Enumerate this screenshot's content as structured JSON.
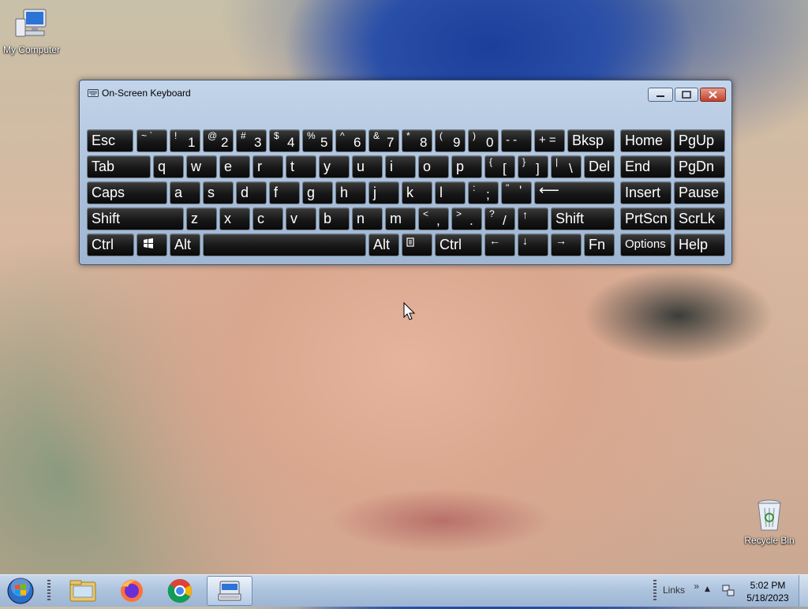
{
  "desktop": {
    "icons": [
      {
        "label": "My Computer",
        "icon": "computer-icon"
      },
      {
        "label": "Recycle Bin",
        "icon": "recycle-bin-icon"
      }
    ]
  },
  "osk": {
    "title": "On-Screen Keyboard",
    "keys": {
      "esc": "Esc",
      "tilde": "~ `",
      "k1s": "!",
      "k1": "1",
      "k2s": "@",
      "k2": "2",
      "k3s": "#",
      "k3": "3",
      "k4s": "$",
      "k4": "4",
      "k5s": "%",
      "k5": "5",
      "k6s": "^",
      "k6": "6",
      "k7s": "&",
      "k7": "7",
      "k8s": "*",
      "k8": "8",
      "k9s": "(",
      "k9": "9",
      "k0s": ")",
      "k0": "0",
      "minus": "- -",
      "plus": "+ =",
      "bksp": "Bksp",
      "home": "Home",
      "pgup": "PgUp",
      "tab": "Tab",
      "q": "q",
      "w": "w",
      "e": "e",
      "r": "r",
      "t": "t",
      "y": "y",
      "u": "u",
      "i": "i",
      "o": "o",
      "p": "p",
      "lbrs": "{",
      "lbr": "[",
      "rbrs": "}",
      "rbr": "]",
      "pipes": "|",
      "pipe": "\\",
      "del": "Del",
      "end": "End",
      "pgdn": "PgDn",
      "caps": "Caps",
      "a": "a",
      "s": "s",
      "d": "d",
      "f": "f",
      "g": "g",
      "h": "h",
      "j": "j",
      "k": "k",
      "l": "l",
      "semis": ":",
      "semi": ";",
      "quotes": "\"",
      "quote": "'",
      "enter": "⟵",
      "insert": "Insert",
      "pause": "Pause",
      "shift": "Shift",
      "z": "z",
      "x": "x",
      "c": "c",
      "v": "v",
      "b": "b",
      "n": "n",
      "m": "m",
      "commas": "<",
      "comma": ",",
      "periods": ">",
      "period": ".",
      "slashs": "?",
      "slash": "/",
      "up": "↑",
      "shift2": "Shift",
      "prtscn": "PrtScn",
      "scrlk": "ScrLk",
      "ctrl": "Ctrl",
      "alt": "Alt",
      "alt2": "Alt",
      "ctrl2": "Ctrl",
      "left": "←",
      "down": "↓",
      "right": "→",
      "fn": "Fn",
      "options": "Options",
      "help": "Help"
    }
  },
  "taskbar": {
    "links": "Links",
    "chevron": "»",
    "tray_arrow": "▲",
    "time": "5:02 PM",
    "date": "5/18/2023",
    "apps": [
      {
        "icon": "start-orb-icon"
      },
      {
        "icon": "file-explorer-icon"
      },
      {
        "icon": "firefox-icon"
      },
      {
        "icon": "chrome-icon"
      },
      {
        "icon": "on-screen-keyboard-icon"
      }
    ]
  }
}
